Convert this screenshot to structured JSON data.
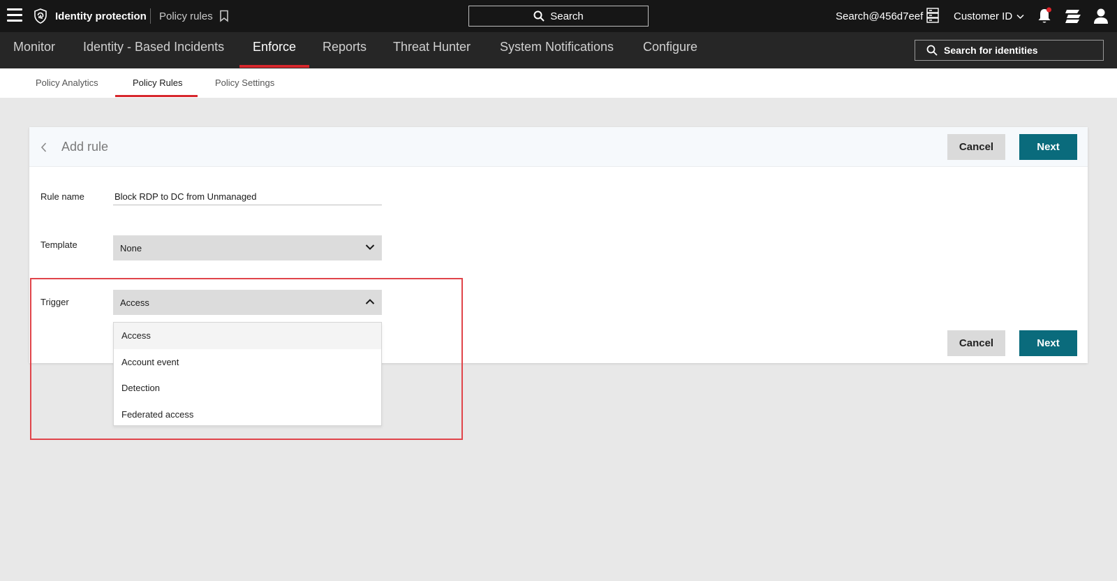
{
  "topbar": {
    "app_title": "Identity protection",
    "page_title": "Policy rules",
    "search_label": "Search",
    "user_email": "Search@456d7eef",
    "customer_label": "Customer ID"
  },
  "nav": {
    "items": [
      "Monitor",
      "Identity - Based Incidents",
      "Enforce",
      "Reports",
      "Threat Hunter",
      "System Notifications",
      "Configure"
    ],
    "active": "Enforce",
    "identity_search": "Search for identities"
  },
  "subtabs": {
    "items": [
      "Policy Analytics",
      "Policy Rules",
      "Policy Settings"
    ],
    "active": "Policy Rules"
  },
  "card": {
    "title": "Add rule",
    "cancel_label": "Cancel",
    "next_label": "Next",
    "rule_name_label": "Rule name",
    "rule_name_value": "Block RDP to DC from Unmanaged",
    "template_label": "Template",
    "template_value": "None",
    "trigger_label": "Trigger",
    "trigger_value": "Access"
  },
  "trigger_options": [
    "Access",
    "Account event",
    "Detection",
    "Federated access"
  ],
  "colors": {
    "accent_red": "#d7262c",
    "primary_teal": "#0a6b7c",
    "highlight_red": "#e0444a"
  }
}
